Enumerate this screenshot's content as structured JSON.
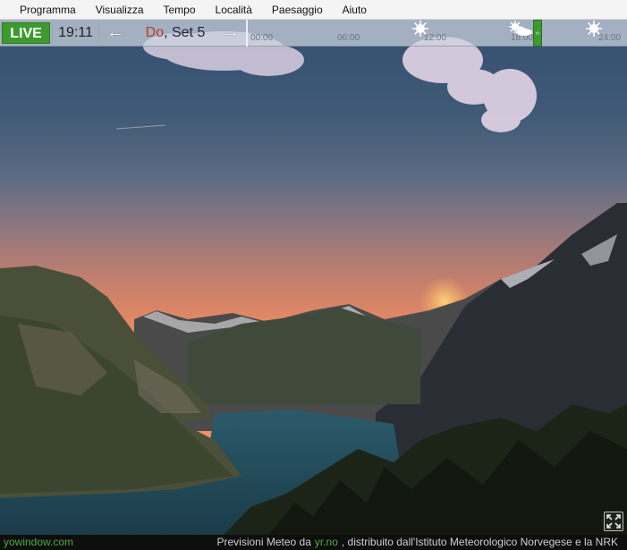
{
  "menu": {
    "items": [
      "Programma",
      "Visualizza",
      "Tempo",
      "Località",
      "Paesaggio",
      "Aiuto"
    ]
  },
  "timebar": {
    "live_label": "LIVE",
    "time": "19:11",
    "date_day": "Do",
    "date_rest": ", Set 5",
    "prev_arrow": "←",
    "next_arrow": "→",
    "ticks": [
      "00:00",
      "06:00",
      "12:00",
      "18:00",
      "24:00"
    ],
    "current_time_fraction": 0.8,
    "weather_icons": [
      "sun-icon",
      "partly-cloudy-icon",
      "sun-icon"
    ],
    "accent_color": "#3c9a2f"
  },
  "status": {
    "site": "yowindow.com",
    "credit_prefix": "Previsioni Meteo da",
    "credit_link": "yr.no",
    "credit_suffix": ", distribuito dall'Istituto Meteorologico Norvegese e la NRK"
  }
}
